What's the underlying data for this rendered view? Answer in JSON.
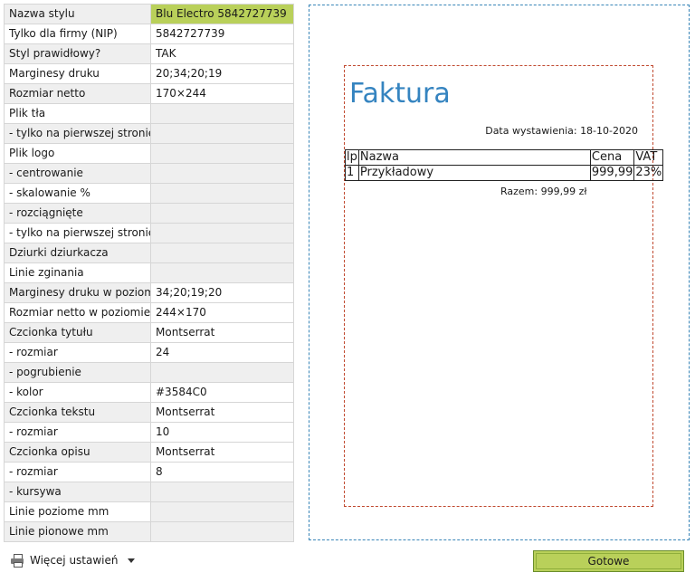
{
  "properties": [
    {
      "key": "Nazwa stylu",
      "value": "Blu Electro 5842727739",
      "state": "hl"
    },
    {
      "key": "Tylko dla firmy (NIP)",
      "value": "5842727739",
      "state": ""
    },
    {
      "key": "Styl prawidłowy?",
      "value": "TAK",
      "state": ""
    },
    {
      "key": "Marginesy druku",
      "value": "20;34;20;19",
      "state": ""
    },
    {
      "key": "Rozmiar netto",
      "value": "170×244",
      "state": ""
    },
    {
      "key": "Plik tła",
      "value": "",
      "state": "empty"
    },
    {
      "key": " - tylko na pierwszej stronie",
      "value": "",
      "state": "empty"
    },
    {
      "key": "Plik logo",
      "value": "",
      "state": "empty"
    },
    {
      "key": " - centrowanie",
      "value": "",
      "state": "empty"
    },
    {
      "key": " - skalowanie %",
      "value": "",
      "state": "empty"
    },
    {
      "key": " - rozciągnięte",
      "value": "",
      "state": "empty"
    },
    {
      "key": " - tylko na pierwszej stronie",
      "value": "",
      "state": "empty"
    },
    {
      "key": "Dziurki dziurkacza",
      "value": "",
      "state": "empty"
    },
    {
      "key": "Linie zginania",
      "value": "",
      "state": "empty"
    },
    {
      "key": "Marginesy druku w poziomie",
      "value": "34;20;19;20",
      "state": ""
    },
    {
      "key": "Rozmiar netto w poziomie",
      "value": "244×170",
      "state": ""
    },
    {
      "key": "Czcionka tytułu",
      "value": "Montserrat",
      "state": ""
    },
    {
      "key": " - rozmiar",
      "value": "24",
      "state": ""
    },
    {
      "key": " - pogrubienie",
      "value": "",
      "state": "empty"
    },
    {
      "key": " - kolor",
      "value": "#3584C0",
      "state": ""
    },
    {
      "key": "Czcionka tekstu",
      "value": "Montserrat",
      "state": ""
    },
    {
      "key": " - rozmiar",
      "value": "10",
      "state": ""
    },
    {
      "key": "Czcionka opisu",
      "value": "Montserrat",
      "state": ""
    },
    {
      "key": " - rozmiar",
      "value": "8",
      "state": ""
    },
    {
      "key": " - kursywa",
      "value": "",
      "state": "empty"
    },
    {
      "key": "Linie poziome mm",
      "value": "",
      "state": "empty"
    },
    {
      "key": "Linie pionowe mm",
      "value": "",
      "state": "empty"
    }
  ],
  "preview": {
    "title": "Faktura",
    "title_color": "#3584C0",
    "date": "Data wystawienia: 18-10-2020",
    "table": {
      "headers": [
        "lp",
        "Nazwa",
        "Cena",
        "VAT"
      ],
      "rows": [
        [
          "1",
          "Przykładowy",
          "999,99",
          "23%"
        ]
      ]
    },
    "total": "Razem: 999,99 zł"
  },
  "footer": {
    "more_settings": "Więcej ustawień",
    "done": "Gotowe"
  },
  "colors": {
    "accent_green": "#b9d05a",
    "outer_page_border": "#3a86b8",
    "inner_page_border": "#c0492f"
  }
}
